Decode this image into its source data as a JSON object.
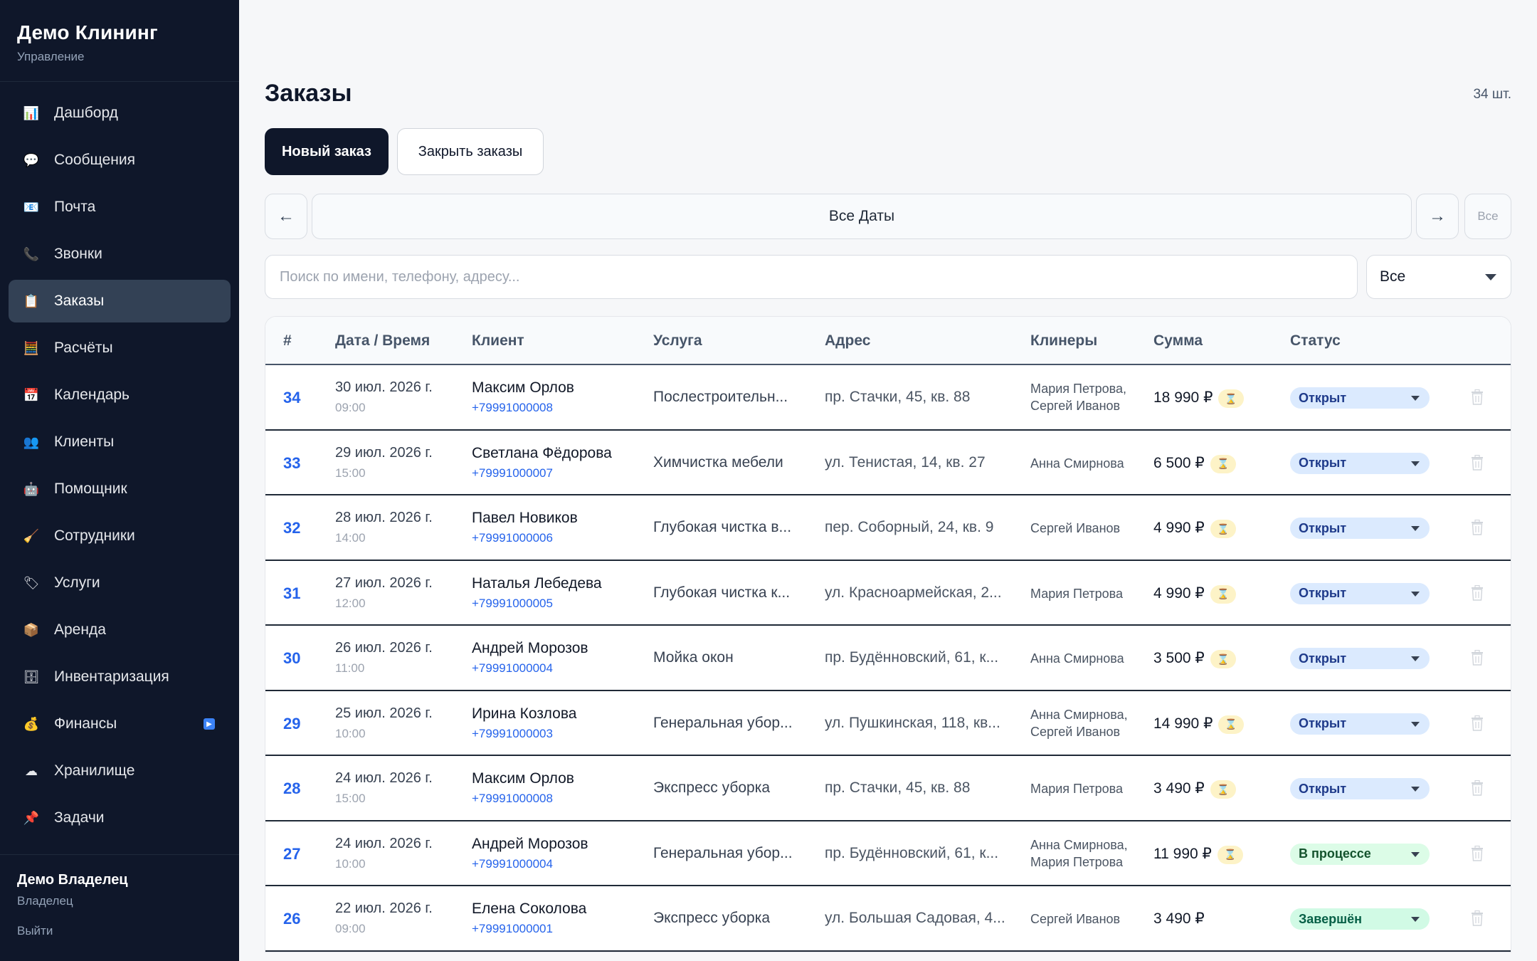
{
  "sidebar": {
    "brand_title": "Демо Клининг",
    "brand_subtitle": "Управление",
    "items": [
      {
        "label": "Дашборд",
        "icon": "chart-icon",
        "glyph": "📊"
      },
      {
        "label": "Сообщения",
        "icon": "chat-bubble-icon",
        "glyph": "💬"
      },
      {
        "label": "Почта",
        "icon": "mail-icon",
        "glyph": "📧"
      },
      {
        "label": "Звонки",
        "icon": "phone-icon",
        "glyph": "📞"
      },
      {
        "label": "Заказы",
        "icon": "clipboard-icon",
        "glyph": "📋"
      },
      {
        "label": "Расчёты",
        "icon": "abacus-icon",
        "glyph": "🧮"
      },
      {
        "label": "Календарь",
        "icon": "calendar-icon",
        "glyph": "📅"
      },
      {
        "label": "Клиенты",
        "icon": "users-icon",
        "glyph": "👥"
      },
      {
        "label": "Помощник",
        "icon": "robot-icon",
        "glyph": "🤖"
      },
      {
        "label": "Сотрудники",
        "icon": "broom-icon",
        "glyph": "🧹"
      },
      {
        "label": "Услуги",
        "icon": "tag-icon",
        "glyph": "🏷"
      },
      {
        "label": "Аренда",
        "icon": "package-icon",
        "glyph": "📦"
      },
      {
        "label": "Инвентаризация",
        "icon": "inventory-icon",
        "glyph": "🗄"
      },
      {
        "label": "Финансы",
        "icon": "money-bag-icon",
        "glyph": "💰"
      },
      {
        "label": "Хранилище",
        "icon": "cloud-icon",
        "glyph": "☁"
      },
      {
        "label": "Задачи",
        "icon": "pin-icon",
        "glyph": "📌"
      }
    ],
    "active_index": 4,
    "user_name": "Демо Владелец",
    "user_role": "Владелец",
    "logout_label": "Выйти"
  },
  "header": {
    "title": "Заказы",
    "count": "34 шт.",
    "new_order_label": "Новый заказ",
    "close_orders_label": "Закрыть заказы"
  },
  "datebar": {
    "prev": "←",
    "label": "Все Даты",
    "next": "→",
    "all": "Все"
  },
  "search": {
    "placeholder": "Поиск по имени, телефону, адресу...",
    "value": ""
  },
  "filter": {
    "selected": "Все"
  },
  "table": {
    "columns": [
      "#",
      "Дата / Время",
      "Клиент",
      "Услуга",
      "Адрес",
      "Клинеры",
      "Сумма",
      "Статус"
    ],
    "rows": [
      {
        "id": "34",
        "date": "30 июл. 2026 г.",
        "time": "09:00",
        "client": "Максим Орлов",
        "phone": "+79991000008",
        "service": "Послестроительн...",
        "address": "пр. Стачки, 45, кв. 88",
        "cleaners": [
          "Мария Петрова,",
          "Сергей Иванов"
        ],
        "sum": "18 990 ₽",
        "pending": true,
        "status": "Открыт",
        "status_type": "open"
      },
      {
        "id": "33",
        "date": "29 июл. 2026 г.",
        "time": "15:00",
        "client": "Светлана Фёдорова",
        "phone": "+79991000007",
        "service": "Химчистка мебели",
        "address": "ул. Тенистая, 14, кв. 27",
        "cleaners": [
          "Анна Смирнова"
        ],
        "sum": "6 500 ₽",
        "pending": true,
        "status": "Открыт",
        "status_type": "open"
      },
      {
        "id": "32",
        "date": "28 июл. 2026 г.",
        "time": "14:00",
        "client": "Павел Новиков",
        "phone": "+79991000006",
        "service": "Глубокая чистка в...",
        "address": "пер. Соборный, 24, кв. 9",
        "cleaners": [
          "Сергей Иванов"
        ],
        "sum": "4 990 ₽",
        "pending": true,
        "status": "Открыт",
        "status_type": "open"
      },
      {
        "id": "31",
        "date": "27 июл. 2026 г.",
        "time": "12:00",
        "client": "Наталья Лебедева",
        "phone": "+79991000005",
        "service": "Глубокая чистка к...",
        "address": "ул. Красноармейская, 2...",
        "cleaners": [
          "Мария Петрова"
        ],
        "sum": "4 990 ₽",
        "pending": true,
        "status": "Открыт",
        "status_type": "open"
      },
      {
        "id": "30",
        "date": "26 июл. 2026 г.",
        "time": "11:00",
        "client": "Андрей Морозов",
        "phone": "+79991000004",
        "service": "Мойка окон",
        "address": "пр. Будённовский, 61, к...",
        "cleaners": [
          "Анна Смирнова"
        ],
        "sum": "3 500 ₽",
        "pending": true,
        "status": "Открыт",
        "status_type": "open"
      },
      {
        "id": "29",
        "date": "25 июл. 2026 г.",
        "time": "10:00",
        "client": "Ирина Козлова",
        "phone": "+79991000003",
        "service": "Генеральная убор...",
        "address": "ул. Пушкинская, 118, кв...",
        "cleaners": [
          "Анна Смирнова,",
          "Сергей Иванов"
        ],
        "sum": "14 990 ₽",
        "pending": true,
        "status": "Открыт",
        "status_type": "open"
      },
      {
        "id": "28",
        "date": "24 июл. 2026 г.",
        "time": "15:00",
        "client": "Максим Орлов",
        "phone": "+79991000008",
        "service": "Экспресс уборка",
        "address": "пр. Стачки, 45, кв. 88",
        "cleaners": [
          "Мария Петрова"
        ],
        "sum": "3 490 ₽",
        "pending": true,
        "status": "Открыт",
        "status_type": "open"
      },
      {
        "id": "27",
        "date": "24 июл. 2026 г.",
        "time": "10:00",
        "client": "Андрей Морозов",
        "phone": "+79991000004",
        "service": "Генеральная убор...",
        "address": "пр. Будённовский, 61, к...",
        "cleaners": [
          "Анна Смирнова,",
          "Мария Петрова"
        ],
        "sum": "11 990 ₽",
        "pending": true,
        "status": "В процессе",
        "status_type": "progress"
      },
      {
        "id": "26",
        "date": "22 июл. 2026 г.",
        "time": "09:00",
        "client": "Елена Соколова",
        "phone": "+79991000001",
        "service": "Экспресс уборка",
        "address": "ул. Большая Садовая, 4...",
        "cleaners": [
          "Сергей Иванов"
        ],
        "sum": "3 490 ₽",
        "pending": false,
        "status": "Завершён",
        "status_type": "done"
      }
    ]
  },
  "colors": {
    "sidebar_bg": "#0f172a",
    "accent": "#2563eb",
    "status_open": "#dbeafe",
    "status_progress": "#dcfce7",
    "status_done": "#d1fae5"
  }
}
